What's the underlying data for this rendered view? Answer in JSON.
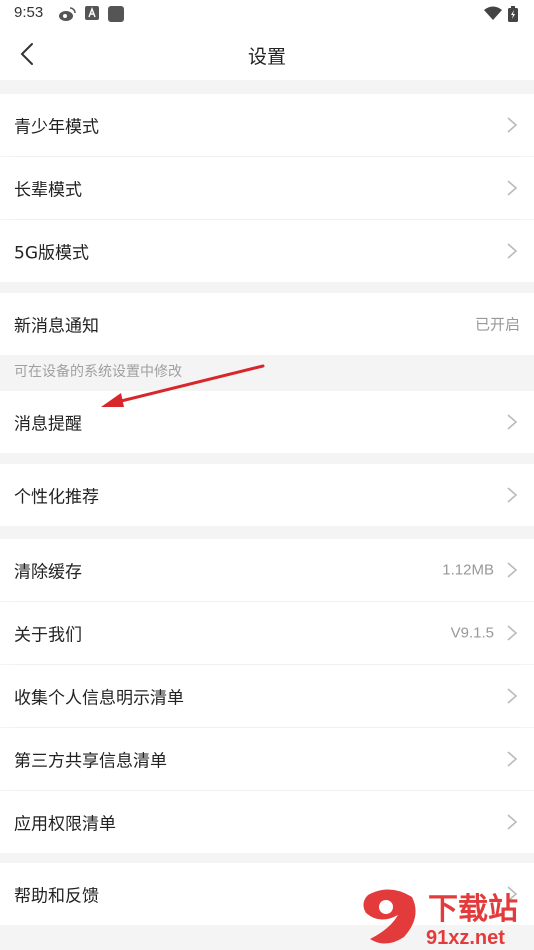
{
  "status_bar": {
    "time": "9:53",
    "icons": [
      "weibo-icon",
      "app-notification-icon",
      "square-app-icon",
      "wifi-icon",
      "battery-icon"
    ]
  },
  "header": {
    "title": "设置"
  },
  "groups": {
    "mode": [
      "青少年模式",
      "长辈模式",
      "5G版模式"
    ],
    "notify": {
      "label": "新消息通知",
      "value": "已开启",
      "hint": "可在设备的系统设置中修改",
      "reminder": "消息提醒"
    },
    "recommend": "个性化推荐",
    "cache": {
      "label": "清除缓存",
      "value": "1.12MB"
    },
    "about": {
      "label": "关于我们",
      "value": "V9.1.5"
    },
    "info": [
      "收集个人信息明示清单",
      "第三方共享信息清单",
      "应用权限清单"
    ],
    "help": "帮助和反馈"
  },
  "watermark": {
    "text": "下载站",
    "domain": "91xz.net"
  },
  "colors": {
    "background": "#f4f4f5",
    "arrow": "#d8262a",
    "watermark": "#e33b3b"
  }
}
